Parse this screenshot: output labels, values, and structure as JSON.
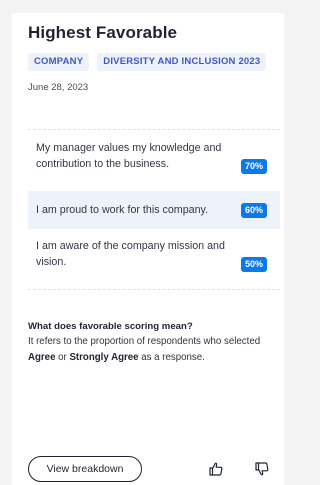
{
  "card": {
    "title": "Highest Favorable",
    "tags": [
      "COMPANY",
      "DIVERSITY AND INCLUSION 2023"
    ],
    "date": "June 28, 2023"
  },
  "statements": [
    {
      "text": "My manager values my knowledge and contribution to the business.",
      "percent": "70%"
    },
    {
      "text": "I am proud to work for this company.",
      "percent": "60%"
    },
    {
      "text": "I am aware of the company mission and vision.",
      "percent": "50%"
    }
  ],
  "explanation": {
    "title": "What does favorable scoring mean?",
    "text_before": "It refers to the proportion of respondents who selected ",
    "bold_1": "Agree",
    "text_middle": " or ",
    "bold_2": "Strongly Agree",
    "text_after": " as a response."
  },
  "footer": {
    "breakdown_label": "View breakdown",
    "thumbs_up_icon": "thumbs-up-icon",
    "thumbs_down_icon": "thumbs-down-icon"
  },
  "colors": {
    "accent": "#0b78ec",
    "tag_background": "#eef2fb",
    "tag_text": "#3f57c4",
    "highlight_row": "#eef3fb"
  }
}
